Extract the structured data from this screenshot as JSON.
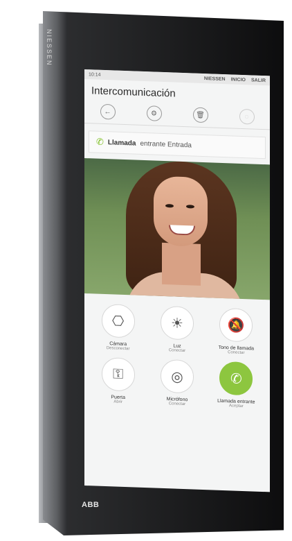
{
  "device": {
    "brand": "NIESSEN",
    "logo": "ABB"
  },
  "status_bar": {
    "time": "10:14",
    "left_text": "NIESSEN",
    "tabs": [
      "NIESSEN",
      "INICIO",
      "SALIR"
    ]
  },
  "screen": {
    "title": "Intercomunicación",
    "toolbar": [
      {
        "icon": "back-icon",
        "glyph": "←"
      },
      {
        "icon": "settings-icon",
        "glyph": "⚙"
      },
      {
        "icon": "trash-icon",
        "glyph": "🗑"
      },
      {
        "icon": "info-icon",
        "glyph": "◌"
      }
    ],
    "call_banner": {
      "label": "Llamada",
      "rest": "entrante Entrada"
    },
    "controls": [
      {
        "id": "camera",
        "glyph": "⎔",
        "label": "Cámara",
        "sub": "Desconectar"
      },
      {
        "id": "light",
        "glyph": "☀",
        "label": "Luz",
        "sub": "Conectar"
      },
      {
        "id": "mute",
        "glyph": "🔕",
        "label": "Tono de llamada",
        "sub": "Conectar"
      },
      {
        "id": "door",
        "glyph": "⚿",
        "label": "Puerta",
        "sub": "Abrir"
      },
      {
        "id": "monitor",
        "glyph": "◎",
        "label": "Micrófono",
        "sub": "Conectar"
      },
      {
        "id": "accept",
        "glyph": "✆",
        "label": "Llamada entrante",
        "sub": "Aceptar"
      }
    ]
  },
  "colors": {
    "accent": "#8dc63f",
    "device": "#0d0d0e"
  }
}
